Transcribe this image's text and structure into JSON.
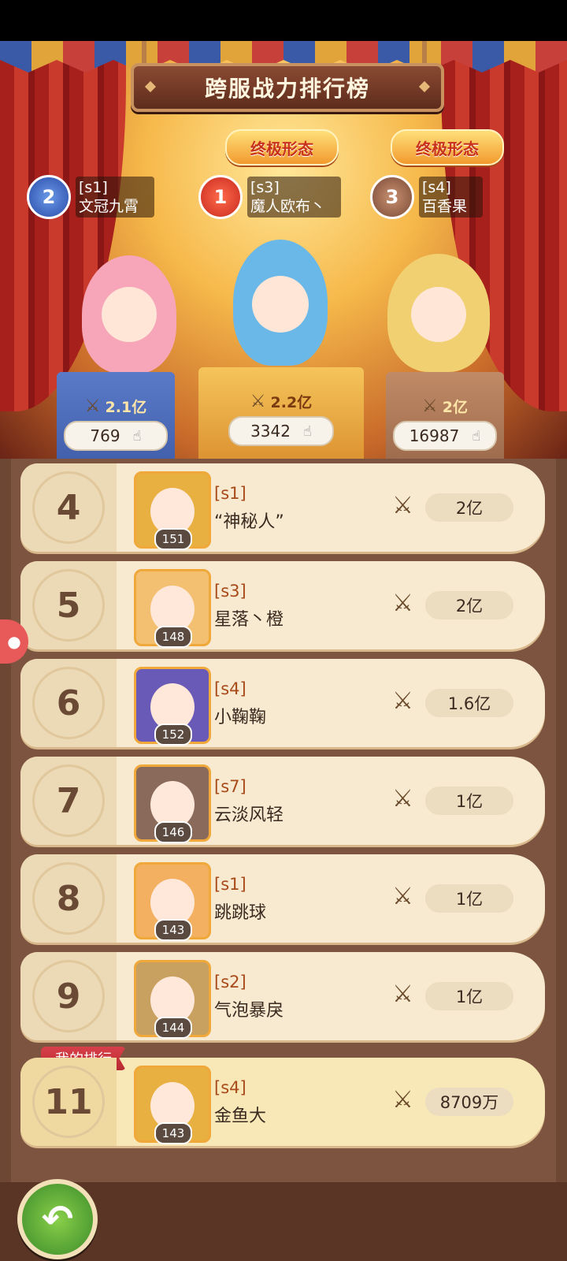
{
  "title": "跨服战力排行榜",
  "ultimate_badges": [
    "终极形态",
    "终极形态"
  ],
  "top3": [
    {
      "medal": "2",
      "server": "[s1]",
      "name": "文冠九霄",
      "power": "2.1亿",
      "likes": "769"
    },
    {
      "medal": "1",
      "server": "[s3]",
      "name": "魔人欧布丶",
      "power": "2.2亿",
      "likes": "3342"
    },
    {
      "medal": "3",
      "server": "[s4]",
      "name": "百香果",
      "power": "2亿",
      "likes": "16987"
    }
  ],
  "rows": [
    {
      "rank": "4",
      "server": "[s1]",
      "name": "“神秘人”",
      "level": "151",
      "power": "2亿"
    },
    {
      "rank": "5",
      "server": "[s3]",
      "name": "星落丶橙",
      "level": "148",
      "power": "2亿"
    },
    {
      "rank": "6",
      "server": "[s4]",
      "name": "小鞠鞠",
      "level": "152",
      "power": "1.6亿"
    },
    {
      "rank": "7",
      "server": "[s7]",
      "name": "云淡风轻",
      "level": "146",
      "power": "1亿"
    },
    {
      "rank": "8",
      "server": "[s1]",
      "name": "跳跳球",
      "level": "143",
      "power": "1亿"
    },
    {
      "rank": "9",
      "server": "[s2]",
      "name": "气泡暴戾",
      "level": "144",
      "power": "1亿"
    }
  ],
  "my_rank": {
    "tag": "我的排行",
    "rank": "11",
    "server": "[s4]",
    "name": "金鱼大",
    "level": "143",
    "power": "8709万"
  },
  "icons": {
    "sword": "sword-icon",
    "like": "hand-like-icon",
    "back": "back-arrow-icon"
  },
  "colors": {
    "accent": "#a84a1a",
    "board": "#7d5440",
    "row": "#f7ead0"
  }
}
